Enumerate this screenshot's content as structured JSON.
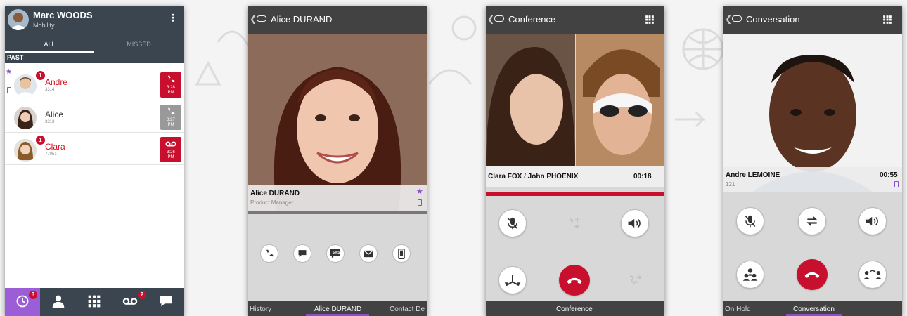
{
  "colors": {
    "header_dark": "#3b4550",
    "accent_purple": "#9c5ed6",
    "alert_red": "#c8102e",
    "call_bar_dark": "#424242",
    "control_grey": "#d8d8d8"
  },
  "call_log": {
    "user_name": "Marc WOODS",
    "user_status": "Mobility",
    "tabs": [
      "ALL",
      "MISSED"
    ],
    "section": "PAST",
    "entries": [
      {
        "name": "Andre",
        "number": "3314",
        "badge": "1",
        "time": "3:28 PM",
        "missed": true,
        "icon": "phone-icon"
      },
      {
        "name": "Alice",
        "number": "3313",
        "badge": "",
        "time": "3:27 PM",
        "missed": false,
        "icon": "phone-icon"
      },
      {
        "name": "Clara",
        "number": "77051",
        "badge": "1",
        "time": "3:26 PM",
        "missed": true,
        "icon": "voicemail-icon"
      }
    ],
    "nav": [
      {
        "icon": "history-icon",
        "badge": "3"
      },
      {
        "icon": "contacts-icon",
        "badge": ""
      },
      {
        "icon": "dialpad-icon",
        "badge": ""
      },
      {
        "icon": "voicemail-icon",
        "badge": "2"
      },
      {
        "icon": "chat-icon",
        "badge": ""
      }
    ]
  },
  "contact_card": {
    "title": "Alice DURAND",
    "name": "Alice DURAND",
    "role": "Product Manager",
    "actions": [
      "call-icon",
      "chat-icon",
      "sms-icon",
      "email-icon",
      "mobile-icon"
    ],
    "sms_label": "SMS",
    "tabs": [
      "History",
      "Alice DURAND",
      "Contact De"
    ]
  },
  "conference": {
    "title": "Conference",
    "participants": "Clara FOX / John PHOENIX",
    "timer": "00:18",
    "footer": "Conference"
  },
  "conversation": {
    "title": "Conversation",
    "name": "Andre LEMOINE",
    "number": "121",
    "timer": "00:55",
    "tabs": [
      "On Hold",
      "Conversation"
    ]
  }
}
